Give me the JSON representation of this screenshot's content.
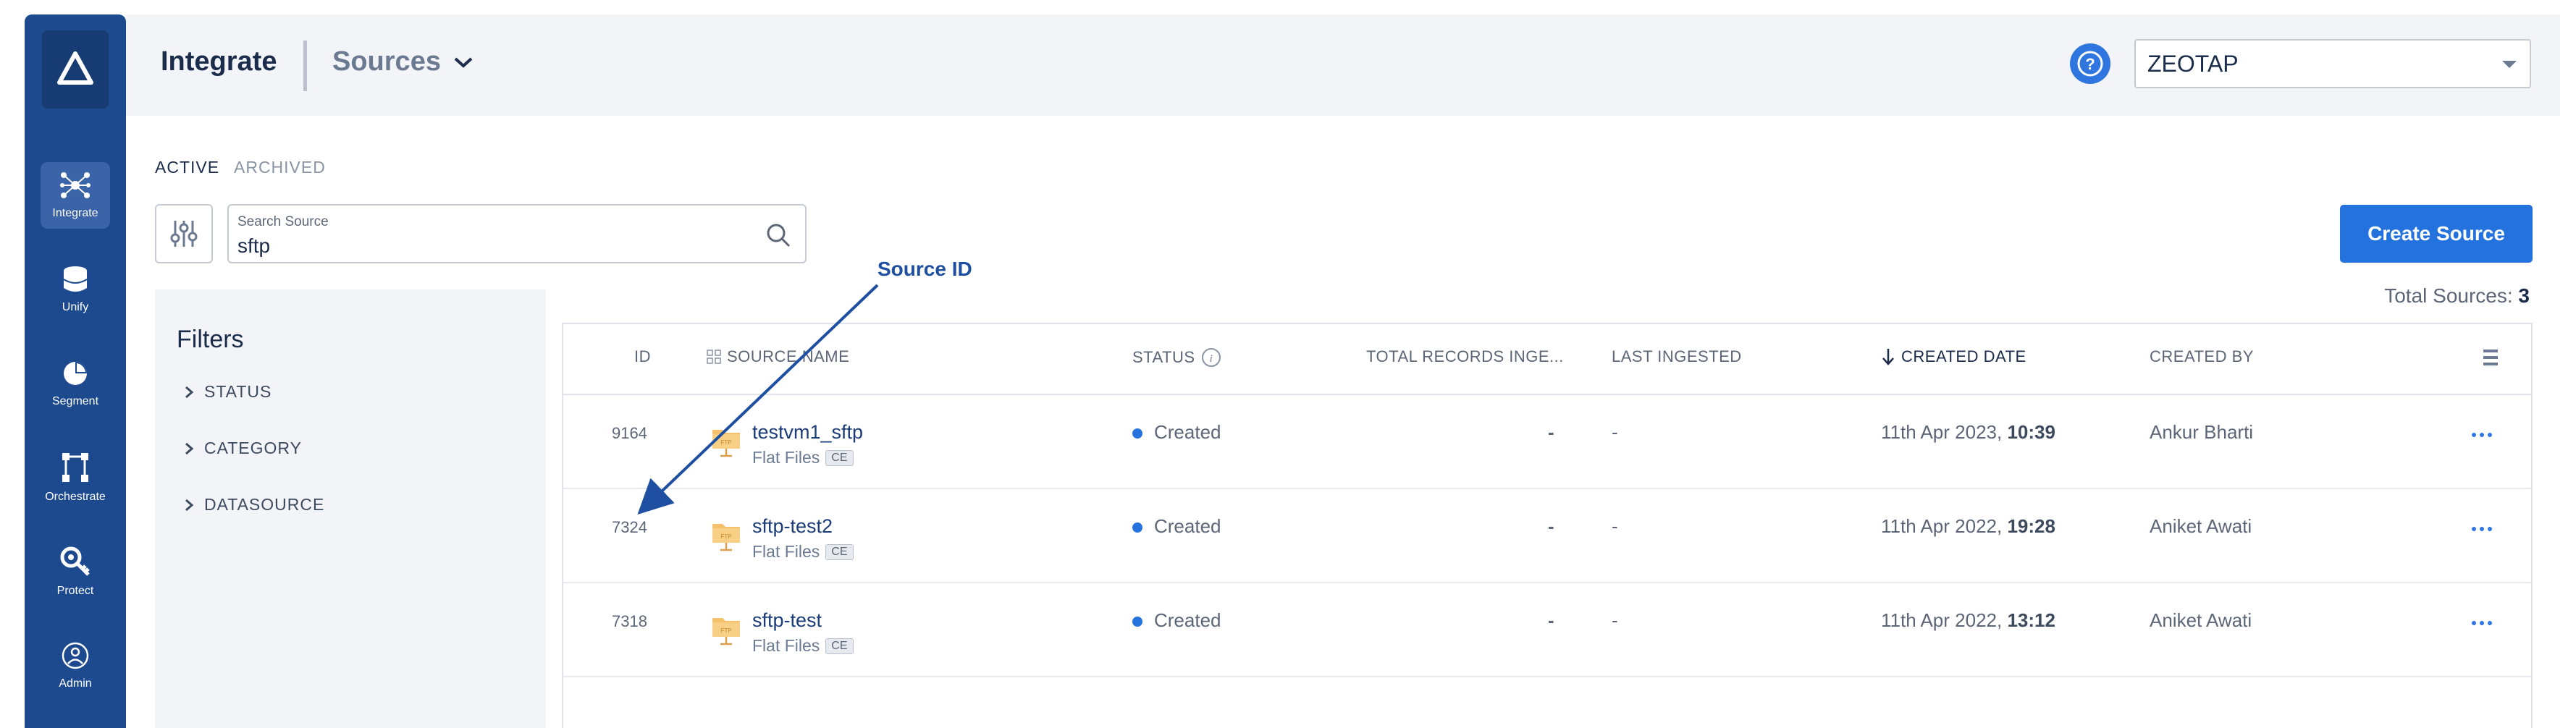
{
  "sidebar": {
    "items": [
      {
        "label": "Integrate",
        "icon": "integrate-icon",
        "active": true
      },
      {
        "label": "Unify",
        "icon": "database-icon",
        "active": false
      },
      {
        "label": "Segment",
        "icon": "pie-chart-icon",
        "active": false
      },
      {
        "label": "Orchestrate",
        "icon": "workflow-icon",
        "active": false
      },
      {
        "label": "Protect",
        "icon": "key-shield-icon",
        "active": false
      },
      {
        "label": "Admin",
        "icon": "user-circle-icon",
        "active": false
      }
    ]
  },
  "header": {
    "title": "Integrate",
    "section": "Sources",
    "org": "ZEOTAP"
  },
  "tabs": [
    {
      "label": "ACTIVE",
      "active": true
    },
    {
      "label": "ARCHIVED",
      "active": false
    }
  ],
  "search": {
    "label": "Search Source",
    "value": "sftp"
  },
  "create_button": "Create Source",
  "total": {
    "label": "Total Sources:",
    "count": "3"
  },
  "filters": {
    "title": "Filters",
    "items": [
      "STATUS",
      "CATEGORY",
      "DATASOURCE"
    ]
  },
  "table": {
    "headers": {
      "id": "ID",
      "source_name": "SOURCE NAME",
      "status": "STATUS",
      "total_records": "TOTAL RECORDS INGE...",
      "last_ingested": "LAST INGESTED",
      "created_date": "CREATED DATE",
      "created_by": "CREATED BY"
    },
    "rows": [
      {
        "id": "9164",
        "name": "testvm1_sftp",
        "type": "Flat Files",
        "badge": "CE",
        "status": "Created",
        "records": "-",
        "last_ingested": "-",
        "date": "11th Apr 2023,",
        "time": "10:39",
        "created_by": "Ankur Bharti"
      },
      {
        "id": "7324",
        "name": "sftp-test2",
        "type": "Flat Files",
        "badge": "CE",
        "status": "Created",
        "records": "-",
        "last_ingested": "-",
        "date": "11th Apr 2022,",
        "time": "19:28",
        "created_by": "Aniket Awati"
      },
      {
        "id": "7318",
        "name": "sftp-test",
        "type": "Flat Files",
        "badge": "CE",
        "status": "Created",
        "records": "-",
        "last_ingested": "-",
        "date": "11th Apr 2022,",
        "time": "13:12",
        "created_by": "Aniket Awati"
      }
    ]
  },
  "annotation": {
    "label": "Source ID"
  },
  "colors": {
    "sidebar": "#1d4a8f",
    "accent": "#2472de",
    "annotation": "#1e4fa0"
  }
}
